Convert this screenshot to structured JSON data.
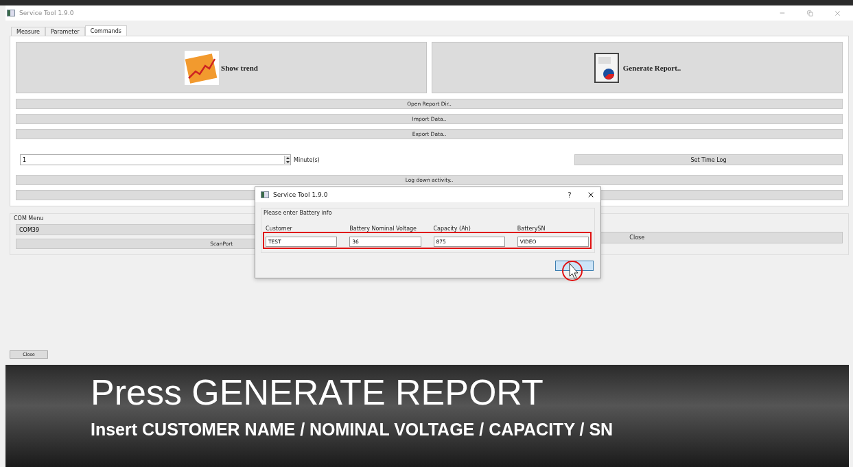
{
  "window": {
    "title": "Service Tool 1.9.0"
  },
  "tabs": [
    {
      "label": "Measure",
      "selected": false
    },
    {
      "label": "Parameter",
      "selected": false
    },
    {
      "label": "Commands",
      "selected": true
    }
  ],
  "big_buttons": [
    {
      "label": "Show trend",
      "kind": "trend"
    },
    {
      "label": "Generate Report..",
      "kind": "report"
    }
  ],
  "command_buttons": [
    "Open Report Dir..",
    "Import Data..",
    "Export Data.."
  ],
  "interval": {
    "value": "1",
    "unit": "Minute(s)",
    "button": "Set Time Log"
  },
  "log_button": "Log down activity..",
  "com_menu": {
    "title": "COM Menu",
    "port": "COM39",
    "scan_button": "ScanPort",
    "close_button": "Close"
  },
  "close_button": "Close",
  "dialog": {
    "title": "Service Tool 1.9.0",
    "help": "?",
    "group": "Please enter Battery info",
    "fields": [
      {
        "label": "Customer",
        "value": "TEST"
      },
      {
        "label": "Battery Nominal Voltage",
        "value": "36"
      },
      {
        "label": "Capacity (Ah)",
        "value": "875"
      },
      {
        "label": "BatterySN",
        "value": "VIDEO"
      }
    ]
  },
  "caption": {
    "title": "Press GENERATE REPORT",
    "subtitle": "Insert CUSTOMER NAME / NOMINAL VOLTAGE / CAPACITY / SN"
  }
}
